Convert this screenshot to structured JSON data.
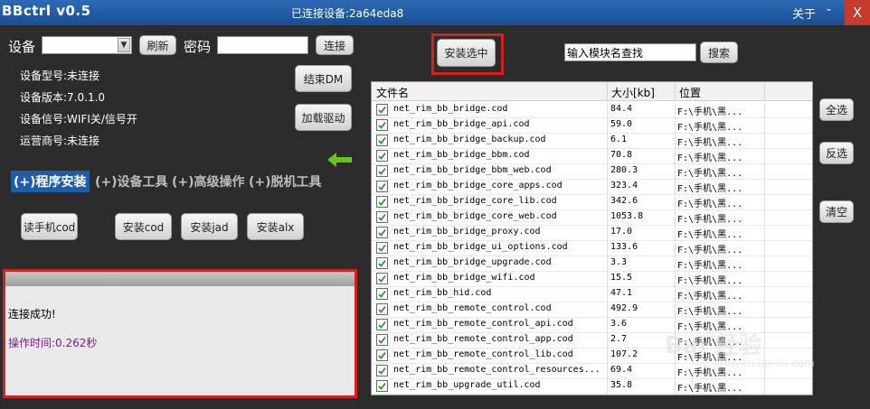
{
  "window": {
    "title": "BBctrl v0.5",
    "connection_status": "已连接设备:2a64eda8",
    "about": "关于",
    "minimize": "-",
    "close": "X"
  },
  "device": {
    "device_label": "设备",
    "refresh": "刷新",
    "password_label": "密码",
    "connect": "连接",
    "end_dm": "结束DM",
    "load_driver": "加载驱动",
    "model": "设备型号:未连接",
    "version": "设备版本:7.0.1.0",
    "signal": "设备信号:WIFI关/信号开",
    "carrier": "运营商号:未连接"
  },
  "tabs": [
    {
      "label": "(+)程序安装",
      "active": true
    },
    {
      "label": "(+)设备工具",
      "active": false
    },
    {
      "label": "(+)高级操作",
      "active": false
    },
    {
      "label": "(+)脱机工具",
      "active": false
    }
  ],
  "actions": {
    "read_cod": "读手机cod",
    "install_cod": "安装cod",
    "install_jad": "安装jad",
    "install_alx": "安装alx"
  },
  "log": {
    "line1": "连接成功!",
    "line2": "操作时间:0.262秒"
  },
  "module_panel": {
    "install_selected": "安装选中",
    "search_value": "输入模块名查找",
    "search": "搜索",
    "select_all": "全选",
    "invert": "反选",
    "clear": "清空"
  },
  "table": {
    "columns": [
      "文件名",
      "大小[kb]",
      "位置"
    ],
    "rows": [
      {
        "name": "net_rim_bb_bridge.cod",
        "size": "84.4",
        "location": "F:\\手机\\黑..."
      },
      {
        "name": "net_rim_bb_bridge_api.cod",
        "size": "59.0",
        "location": "F:\\手机\\黑..."
      },
      {
        "name": "net_rim_bb_bridge_backup.cod",
        "size": "6.1",
        "location": "F:\\手机\\黑..."
      },
      {
        "name": "net_rim_bb_bridge_bbm.cod",
        "size": "70.8",
        "location": "F:\\手机\\黑..."
      },
      {
        "name": "net_rim_bb_bridge_bbm_web.cod",
        "size": "280.3",
        "location": "F:\\手机\\黑..."
      },
      {
        "name": "net_rim_bb_bridge_core_apps.cod",
        "size": "323.4",
        "location": "F:\\手机\\黑..."
      },
      {
        "name": "net_rim_bb_bridge_core_lib.cod",
        "size": "342.6",
        "location": "F:\\手机\\黑..."
      },
      {
        "name": "net_rim_bb_bridge_core_web.cod",
        "size": "1053.8",
        "location": "F:\\手机\\黑..."
      },
      {
        "name": "net_rim_bb_bridge_proxy.cod",
        "size": "17.0",
        "location": "F:\\手机\\黑..."
      },
      {
        "name": "net_rim_bb_bridge_ui_options.cod",
        "size": "133.6",
        "location": "F:\\手机\\黑..."
      },
      {
        "name": "net_rim_bb_bridge_upgrade.cod",
        "size": "3.3",
        "location": "F:\\手机\\黑..."
      },
      {
        "name": "net_rim_bb_bridge_wifi.cod",
        "size": "15.5",
        "location": "F:\\手机\\黑..."
      },
      {
        "name": "net_rim_bb_hid.cod",
        "size": "47.1",
        "location": "F:\\手机\\黑..."
      },
      {
        "name": "net_rim_bb_remote_control.cod",
        "size": "492.9",
        "location": "F:\\手机\\黑..."
      },
      {
        "name": "net_rim_bb_remote_control_api.cod",
        "size": "3.6",
        "location": "F:\\手机\\黑..."
      },
      {
        "name": "net_rim_bb_remote_control_app.cod",
        "size": "2.7",
        "location": "F:\\手机\\黑..."
      },
      {
        "name": "net_rim_bb_remote_control_lib.cod",
        "size": "107.2",
        "location": "F:\\手机\\黑..."
      },
      {
        "name": "net_rim_bb_remote_control_resources...",
        "size": "69.4",
        "location": "F:\\手机\\黑..."
      },
      {
        "name": "net_rim_bb_upgrade_util.cod",
        "size": "35.8",
        "location": "F:\\手机\\黑..."
      }
    ]
  },
  "watermark": {
    "text": "Bai 经验",
    "sub": "jingyan.baidu.com"
  },
  "colors": {
    "titlebar": "#1f5ea6",
    "highlight": "#d72020",
    "arrow": "#6ac21a",
    "log_time": "#7a1e8c"
  }
}
